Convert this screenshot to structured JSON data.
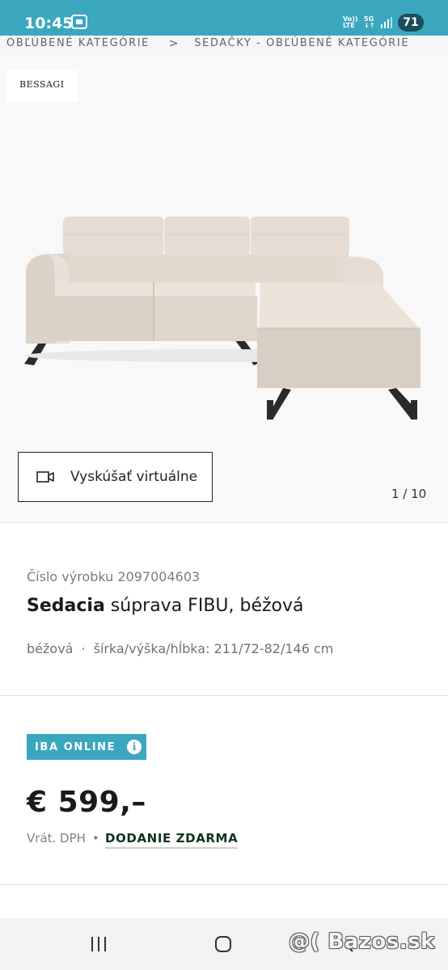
{
  "status_bar": {
    "time": "10:45",
    "signal_top": "Vo))",
    "signal_bottom": "LTE",
    "network_top": "5G",
    "network_bottom": "↓↑",
    "battery": "71"
  },
  "breadcrumb": {
    "items": [
      "OBĽÚBENÉ KATEGÓRIE",
      "SEDAČKY - OBĽÚBENÉ KATEGÓRIE"
    ],
    "separator": ">"
  },
  "gallery": {
    "brand": "BESSAGI",
    "try_button_label": "Vyskúšať virtuálne",
    "counter": "1 / 10"
  },
  "product": {
    "number_label": "Číslo výrobku 2097004603",
    "title_bold": "Sedacia",
    "title_rest": " súprava FIBU, béžová",
    "color": "béžová",
    "spec_separator": "·",
    "dimensions": "šírka/výška/hĺbka: 211/72-82/146 cm"
  },
  "offer": {
    "badge_label": "IBA ONLINE",
    "badge_icon": "i",
    "price": "€ 599,–",
    "vat_label": "Vrát. DPH",
    "separator": "•",
    "delivery_label": "DODANIE ZDARMA"
  },
  "watermark": "@( Bazos.sk",
  "colors": {
    "accent": "#3ba7bf",
    "status_bar": "#3ba7bf",
    "battery_bg": "#1c4e5c",
    "sofa": "#e6dcd3",
    "delivery_text": "#10331c"
  }
}
